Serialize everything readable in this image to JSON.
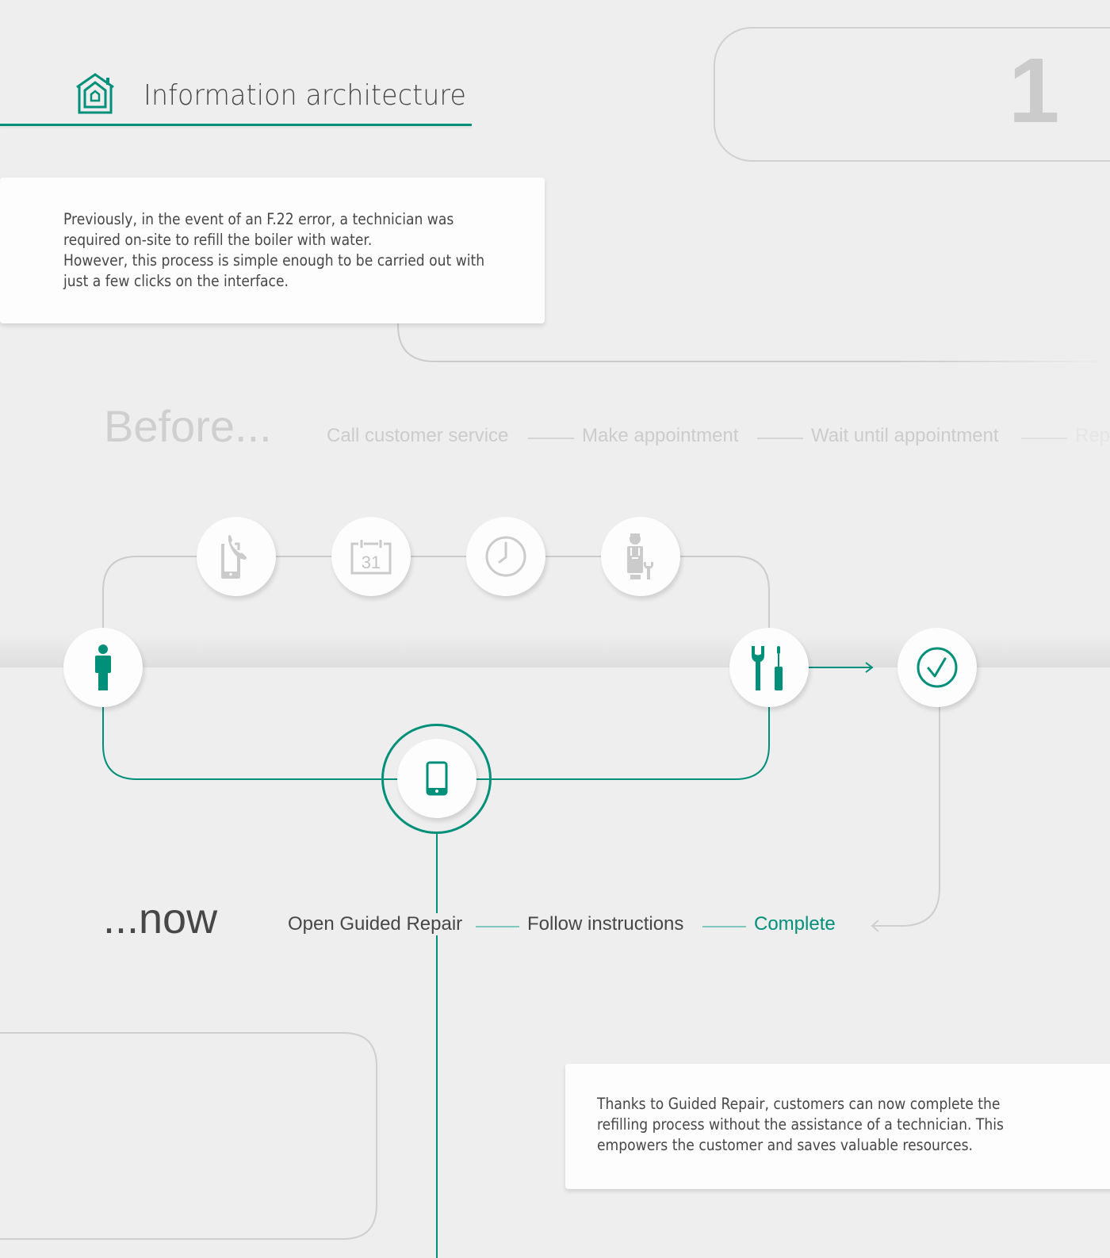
{
  "header": {
    "title": "Information architecture",
    "icon": "house-icon",
    "step_number": "1"
  },
  "cards": {
    "before_text": [
      "Previously, in the event of an F.22 error, a technician was",
      "required on-site to refill the boiler with water.",
      "However, this process is simple enough to be carried out with",
      "just a few clicks on the interface."
    ],
    "now_text": [
      "Thanks to Guided Repair, customers can now complete the",
      "refilling process without the assistance of a technician. This",
      "empowers the customer and saves valuable resources."
    ]
  },
  "before": {
    "title": "Before...",
    "steps": [
      "Call customer service",
      "Make appointment",
      "Wait until appointment",
      "Repair"
    ],
    "icons": [
      "phone-call-icon",
      "calendar-icon",
      "clock-icon",
      "technician-icon"
    ],
    "calendar_day": "31"
  },
  "now": {
    "title": "...now",
    "steps": [
      "Open Guided Repair",
      "Follow instructions",
      "Complete"
    ],
    "icon": "smartphone-icon"
  },
  "nodes": {
    "start": "person-icon",
    "repair": "tools-icon",
    "done": "checkmark-circle-icon"
  },
  "colors": {
    "accent": "#00907a",
    "muted": "#cccccc",
    "text": "#474747",
    "background": "#eeeeee"
  }
}
